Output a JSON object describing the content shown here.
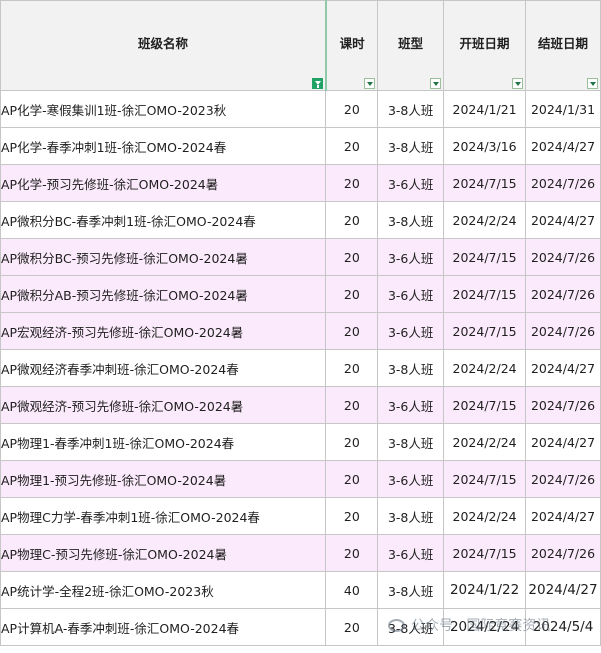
{
  "headers": {
    "name": "班级名称",
    "hours": "课时",
    "type": "班型",
    "start": "开班日期",
    "end": "结班日期"
  },
  "rows": [
    {
      "name": "AP化学-寒假集训1班-徐汇OMO-2023秋",
      "hours": "20",
      "type": "3-8人班",
      "start": "2024/1/21",
      "end": "2024/1/31",
      "highlight": false
    },
    {
      "name": "AP化学-春季冲刺1班-徐汇OMO-2024春",
      "hours": "20",
      "type": "3-8人班",
      "start": "2024/3/16",
      "end": "2024/4/27",
      "highlight": false
    },
    {
      "name": "AP化学-预习先修班-徐汇OMO-2024暑",
      "hours": "20",
      "type": "3-6人班",
      "start": "2024/7/15",
      "end": "2024/7/26",
      "highlight": true
    },
    {
      "name": "AP微积分BC-春季冲刺1班-徐汇OMO-2024春",
      "hours": "20",
      "type": "3-8人班",
      "start": "2024/2/24",
      "end": "2024/4/27",
      "highlight": false
    },
    {
      "name": "AP微积分BC-预习先修班-徐汇OMO-2024暑",
      "hours": "20",
      "type": "3-6人班",
      "start": "2024/7/15",
      "end": "2024/7/26",
      "highlight": true
    },
    {
      "name": "AP微积分AB-预习先修班-徐汇OMO-2024暑",
      "hours": "20",
      "type": "3-6人班",
      "start": "2024/7/15",
      "end": "2024/7/26",
      "highlight": true
    },
    {
      "name": "AP宏观经济-预习先修班-徐汇OMO-2024暑",
      "hours": "20",
      "type": "3-6人班",
      "start": "2024/7/15",
      "end": "2024/7/26",
      "highlight": true
    },
    {
      "name": "AP微观经济春季冲刺班-徐汇OMO-2024春",
      "hours": "20",
      "type": "3-8人班",
      "start": "2024/2/24",
      "end": "2024/4/27",
      "highlight": false
    },
    {
      "name": "AP微观经济-预习先修班-徐汇OMO-2024暑",
      "hours": "20",
      "type": "3-6人班",
      "start": "2024/7/15",
      "end": "2024/7/26",
      "highlight": true
    },
    {
      "name": "AP物理1-春季冲刺1班-徐汇OMO-2024春",
      "hours": "20",
      "type": "3-8人班",
      "start": "2024/2/24",
      "end": "2024/4/27",
      "highlight": false
    },
    {
      "name": "AP物理1-预习先修班-徐汇OMO-2024暑",
      "hours": "20",
      "type": "3-6人班",
      "start": "2024/7/15",
      "end": "2024/7/26",
      "highlight": true
    },
    {
      "name": "AP物理C力学-春季冲刺1班-徐汇OMO-2024春",
      "hours": "20",
      "type": "3-8人班",
      "start": "2024/2/24",
      "end": "2024/4/27",
      "highlight": false
    },
    {
      "name": "AP物理C-预习先修班-徐汇OMO-2024暑",
      "hours": "20",
      "type": "3-6人班",
      "start": "2024/7/15",
      "end": "2024/7/26",
      "highlight": true
    },
    {
      "name": "AP统计学-全程2班-徐汇OMO-2023秋",
      "hours": "40",
      "type": "3-8人班",
      "start": "2024/1/22",
      "end": "2024/4/27",
      "highlight": false,
      "big": true
    },
    {
      "name": "AP计算机A-春季冲刺班-徐汇OMO-2024春",
      "hours": "20",
      "type": "3-8人班",
      "start": "2024/2/24",
      "end": "2024/5/4",
      "highlight": false,
      "big": true
    }
  ],
  "watermark": "公众号 · 国际竞赛资讯",
  "colors": {
    "highlight_row": "#fbeafb",
    "header_bg": "#f2f2f2",
    "filter_active": "#21a366",
    "grid": "#c6c6c6"
  }
}
